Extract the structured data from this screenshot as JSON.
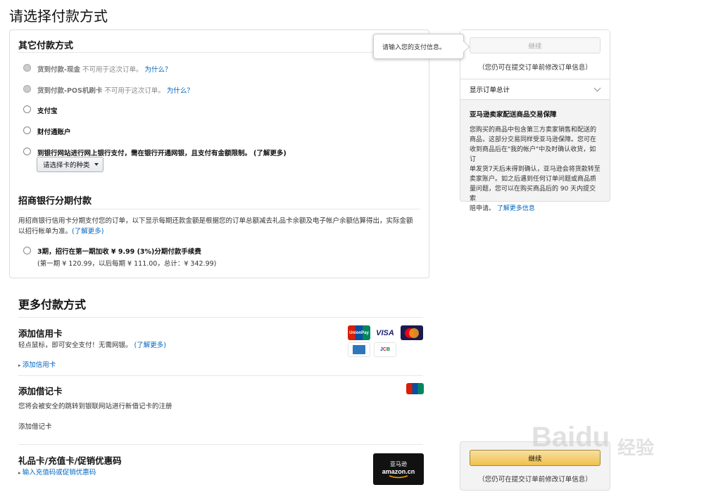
{
  "page": {
    "title": "请选择付款方式"
  },
  "other_methods": {
    "title": "其它付款方式",
    "options": [
      {
        "label": "货到付款-现金",
        "note": "不可用于这次订单。",
        "link": "为什么？",
        "disabled": true
      },
      {
        "label": "货到付款-POS机刷卡",
        "note": "不可用于这次订单。",
        "link": "为什么？",
        "disabled": true
      },
      {
        "label": "支付宝",
        "disabled": false
      },
      {
        "label": "财付通账户",
        "disabled": false
      },
      {
        "label": "到银行网站进行网上银行支付，需在银行开通网银，且支付有金额限制。",
        "link": "(了解更多)",
        "disabled": false
      }
    ],
    "card_type_select": "请选择卡的种类"
  },
  "installment": {
    "title": "招商银行分期付款",
    "description_line1": "用招商银行信用卡分期支付您的订单，以下显示每期还款金额是根据您的订单总额减去礼品卡余额及电子帐户余额估算得出，实际金额",
    "description_line2": "以招行帐单为准。",
    "learn_more": "(了解更多)",
    "option_label": "3期，招行在第一期加收 ¥ 9.99 (3%)分期付款手续费",
    "option_detail": "(第一期 ¥ 120.99，以后每期 ¥ 111.00，总计：¥ 342.99)"
  },
  "more_methods": {
    "title": "更多付款方式",
    "credit": {
      "title": "添加信用卡",
      "desc": "轻点鼠标，即可安全支付！无需网银。",
      "learn_more": "(了解更多)",
      "link": "添加信用卡",
      "card_logos": [
        "UnionPay",
        "VISA",
        "MasterCard",
        "American Express",
        "JCB"
      ]
    },
    "debit": {
      "title": "添加借记卡",
      "desc": "您将会被安全的跳转到银联网站进行新借记卡的注册",
      "link": "添加借记卡"
    },
    "gift": {
      "title": "礼品卡/充值卡/促销优惠码",
      "link": "输入充值码或促销优惠码",
      "card_text_cn": "亚马逊",
      "card_text_en": "amazon.cn"
    }
  },
  "sidebar": {
    "tooltip": "请输入您的支付信息。",
    "continue": "继续",
    "edit_note": "（您仍可在提交订单前修改订单信息）",
    "order_total": "显示订单总计",
    "guarantee_title": "亚马逊卖家配送商品交易保障",
    "guarantee_lines": [
      "您购买的商品中包含第三方卖家销售和配送的",
      "商品，这部分交易同样受亚马逊保障。您可在",
      "收到商品后在\"我的帐户\"中及时确认收货，如订",
      "单发货7天后未得到确认，亚马逊会将货款转至",
      "卖家账户。如之后遇到任何订单问题或商品质",
      "量问题，您可以在购买商品后的 90 天内提交索",
      "赔申请。"
    ],
    "guarantee_link": "了解更多信息"
  },
  "bottom": {
    "continue": "继续",
    "edit_note": "（您仍可在提交订单前修改订单信息）"
  },
  "watermark": {
    "text": "Baidu",
    "cn": "经验"
  },
  "colors": {
    "link": "#0066c0",
    "button_gold": "#f0c14b",
    "border": "#dddddd"
  }
}
